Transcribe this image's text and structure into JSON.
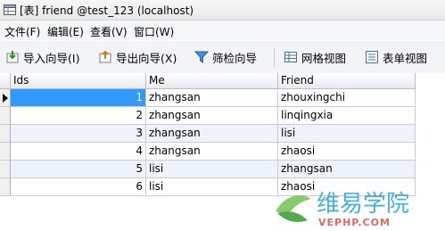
{
  "window": {
    "title": "[表] friend @test_123 (localhost)"
  },
  "menu": {
    "items": [
      "文件(F)",
      "编辑(E)",
      "查看(V)",
      "窗口(W)"
    ]
  },
  "toolbar": {
    "import_label": "导入向导(I)",
    "export_label": "导出向导(X)",
    "filter_label": "筛检向导",
    "grid_view_label": "网格视图",
    "form_view_label": "表单视图"
  },
  "table": {
    "columns": [
      "Ids",
      "Me",
      "Friend"
    ],
    "rows": [
      {
        "ids": "1",
        "me": "zhangsan",
        "friend": "zhouxingchi"
      },
      {
        "ids": "2",
        "me": "zhangsan",
        "friend": "linqingxia"
      },
      {
        "ids": "3",
        "me": "zhangsan",
        "friend": "lisi"
      },
      {
        "ids": "4",
        "me": "zhangsan",
        "friend": "zhaosi"
      },
      {
        "ids": "5",
        "me": "lisi",
        "friend": "zhangsan"
      },
      {
        "ids": "6",
        "me": "lisi",
        "friend": "zhaosi"
      }
    ],
    "selected_row": 1
  },
  "watermark": {
    "name": "维易学院",
    "site": "VEPHP.COM"
  },
  "colors": {
    "selection": "#3399ff",
    "alt_row": "#eef3fb",
    "watermark": "#2fa3d8"
  }
}
